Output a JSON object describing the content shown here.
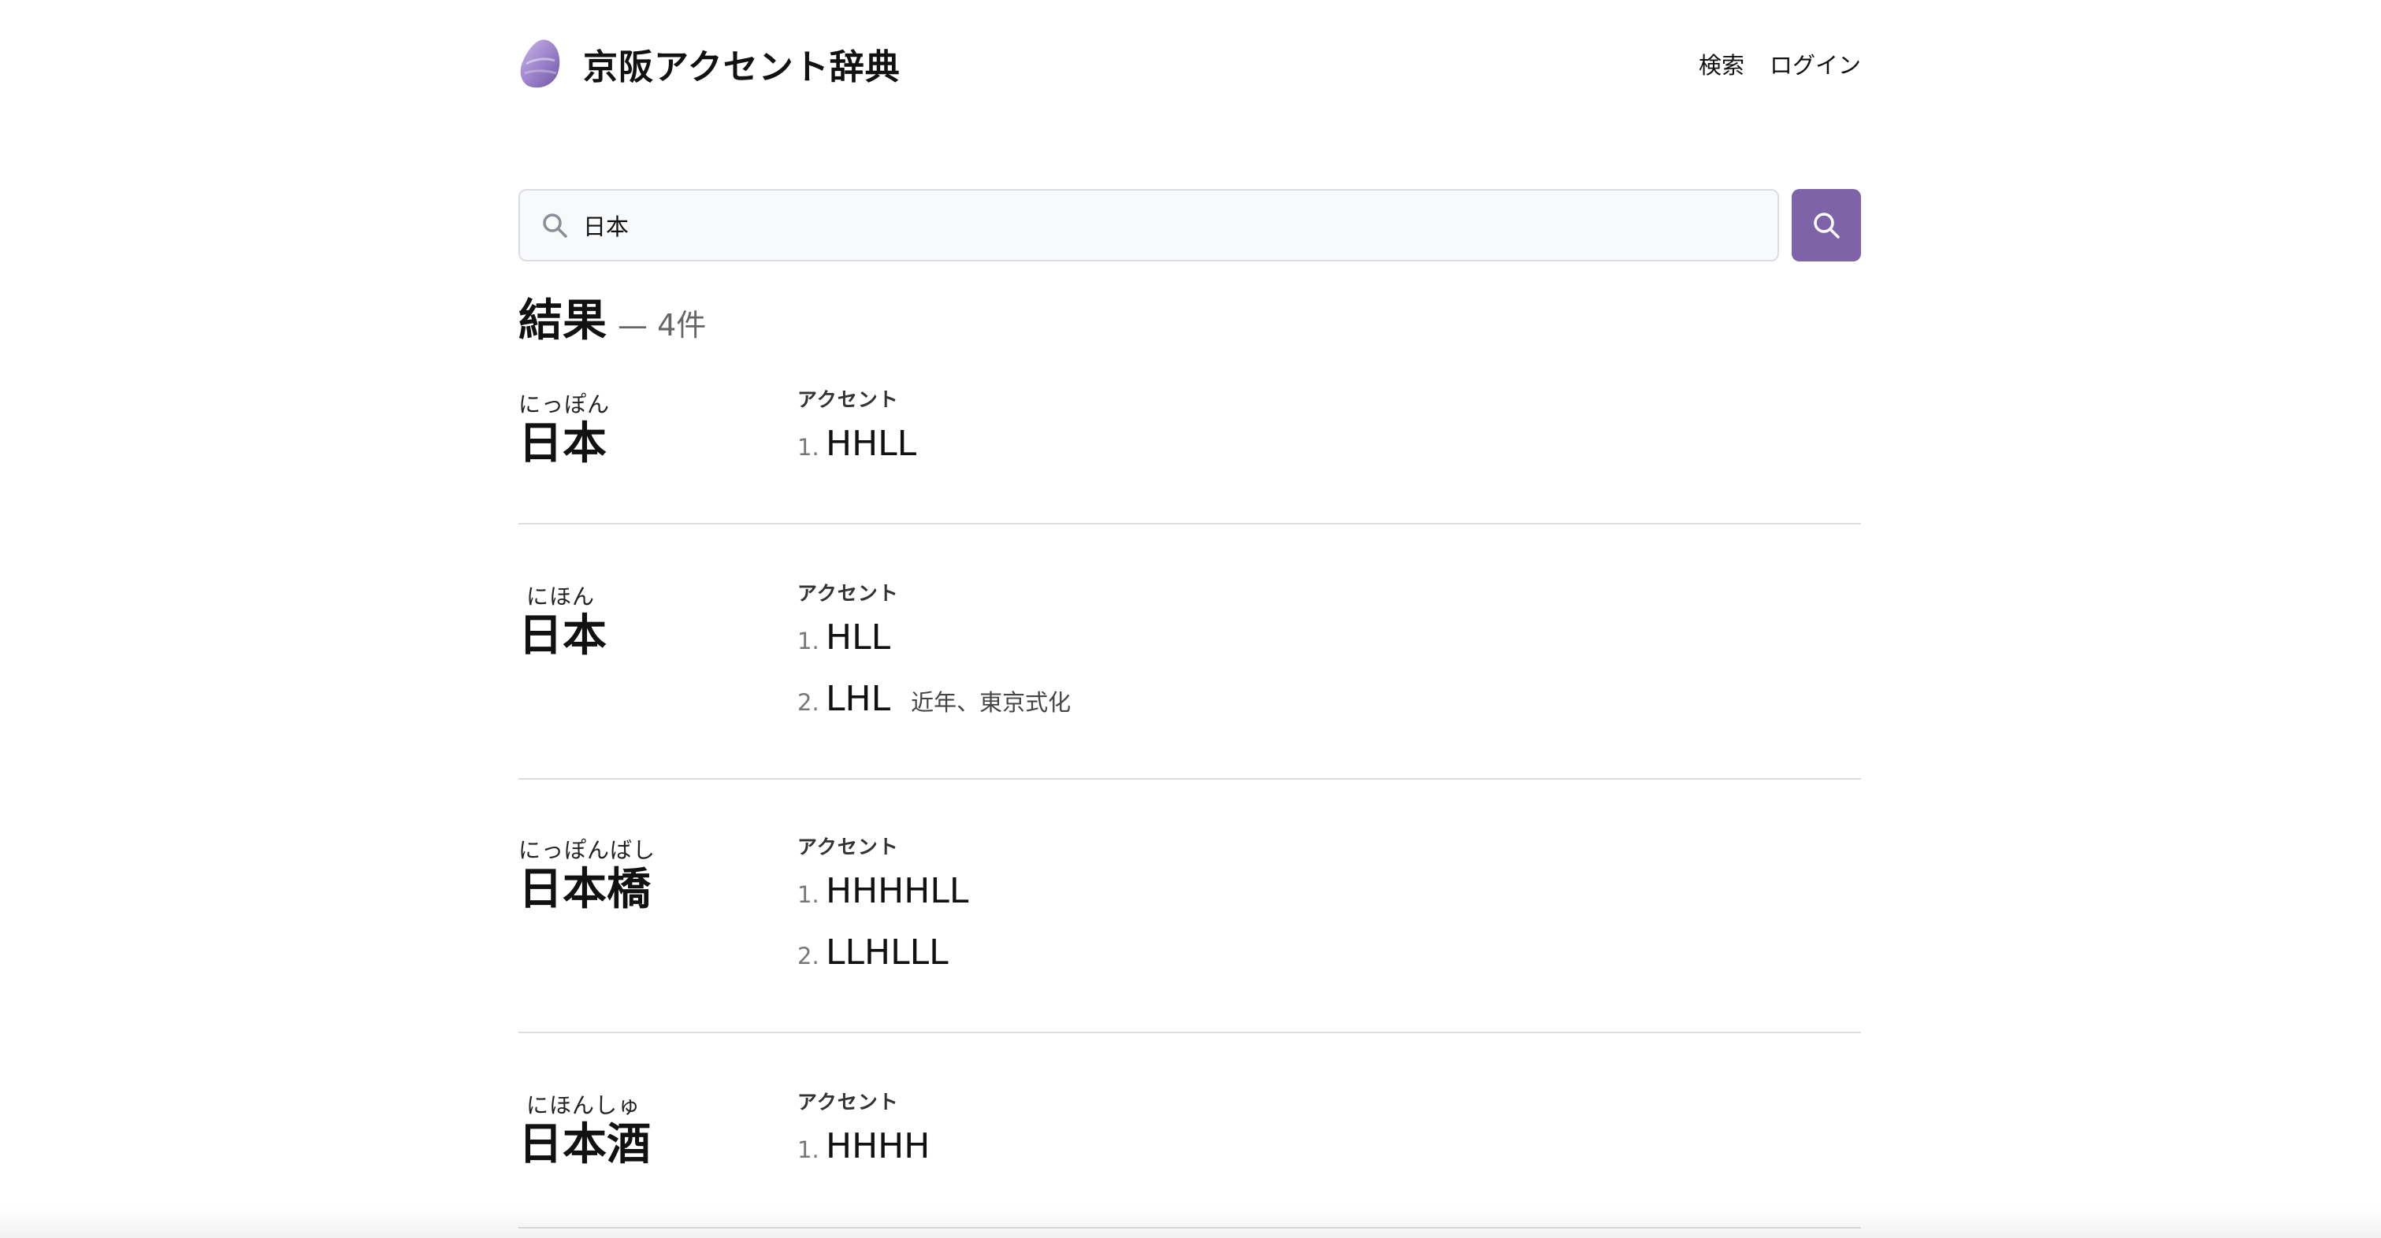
{
  "header": {
    "site_title": "京阪アクセント辞典",
    "nav": [
      {
        "label": "検索"
      },
      {
        "label": "ログイン"
      }
    ]
  },
  "search": {
    "value": "日本",
    "icon": "search-icon",
    "button_icon": "search-icon"
  },
  "results": {
    "title": "結果",
    "count": "— 4件"
  },
  "entries": [
    {
      "reading": "にっぽん",
      "headword": "日本",
      "accent_label": "アクセント",
      "accents": [
        {
          "num": "1.",
          "pattern": "HHLL",
          "note": ""
        }
      ]
    },
    {
      "reading": "にほん",
      "headword": "日本",
      "accent_label": "アクセント",
      "accents": [
        {
          "num": "1.",
          "pattern": "HLL",
          "note": ""
        },
        {
          "num": "2.",
          "pattern": "LHL",
          "note": "近年、東京式化"
        }
      ]
    },
    {
      "reading": "にっぽんばし",
      "headword": "日本橋",
      "accent_label": "アクセント",
      "accents": [
        {
          "num": "1.",
          "pattern": "HHHHLL",
          "note": ""
        },
        {
          "num": "2.",
          "pattern": "LLHLLL",
          "note": ""
        }
      ]
    },
    {
      "reading": "にほんしゅ",
      "headword": "日本酒",
      "accent_label": "アクセント",
      "accents": [
        {
          "num": "1.",
          "pattern": "HHHH",
          "note": ""
        }
      ]
    }
  ],
  "colors": {
    "accent": "#7f63a9",
    "divider": "#dedede"
  }
}
